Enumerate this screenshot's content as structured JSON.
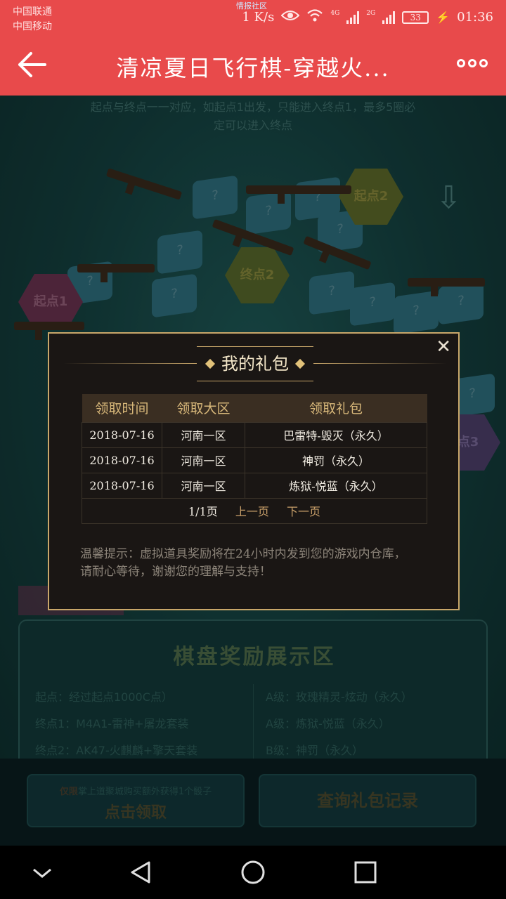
{
  "status_bar": {
    "carrier_1": "中国联通",
    "carrier_2": "中国移动",
    "center_label": "情报社区",
    "net_speed": "1 K/s",
    "net_4g": "4G",
    "net_2g": "2G",
    "battery": "33",
    "time": "01:36"
  },
  "app_bar": {
    "title": "清凉夏日飞行棋-穿越火...",
    "back_icon": "arrow-left-icon",
    "more_icon": "more-dots-icon"
  },
  "background": {
    "rules_line_1": "起点与终点一一对应，如起点1出发，只能进入终点1，最多5圈必",
    "rules_line_2": "定可以进入终点",
    "start_1": "起点1",
    "start_2": "起点2",
    "end_2": "终点2",
    "partial_3": "点3",
    "unknown_mark": "?",
    "reward_title": "棋盘奖励展示区",
    "reward_left": [
      "起点：经过起点1000C点）",
      "终点1：M4A1-雷神+屠龙套装",
      "终点2：AK47-火麒麟+擎天套装"
    ],
    "reward_right": [
      "A级：玫瑰精灵-炫动（永久）",
      "A级：炼狱-悦蓝（永久）",
      "B级：神罚（永久）"
    ]
  },
  "bottom_buttons": {
    "claim_note_prefix": "仅限",
    "claim_note": "掌上道聚城购买额外获得1个骰子",
    "claim_label": "点击领取",
    "records_label": "查询礼包记录"
  },
  "modal": {
    "title": "我的礼包",
    "close_icon": "close-icon",
    "columns": [
      "领取时间",
      "领取大区",
      "领取礼包"
    ],
    "rows": [
      {
        "time": "2018-07-16",
        "region": "河南一区",
        "gift": "巴雷特-毁灭（永久）"
      },
      {
        "time": "2018-07-16",
        "region": "河南一区",
        "gift": "神罚（永久）"
      },
      {
        "time": "2018-07-16",
        "region": "河南一区",
        "gift": "炼狱-悦蓝（永久）"
      }
    ],
    "pager": {
      "page_info": "1/1页",
      "prev": "上一页",
      "next": "下一页"
    },
    "tip_1": "温馨提示：虚拟道具奖励将在24小时内发到您的游戏内仓库，",
    "tip_2": "请耐心等待，谢谢您的理解与支持！"
  },
  "nav_bar": {
    "icons": [
      "chevron-down-icon",
      "back-triangle-icon",
      "home-circle-icon",
      "recents-square-icon"
    ]
  }
}
